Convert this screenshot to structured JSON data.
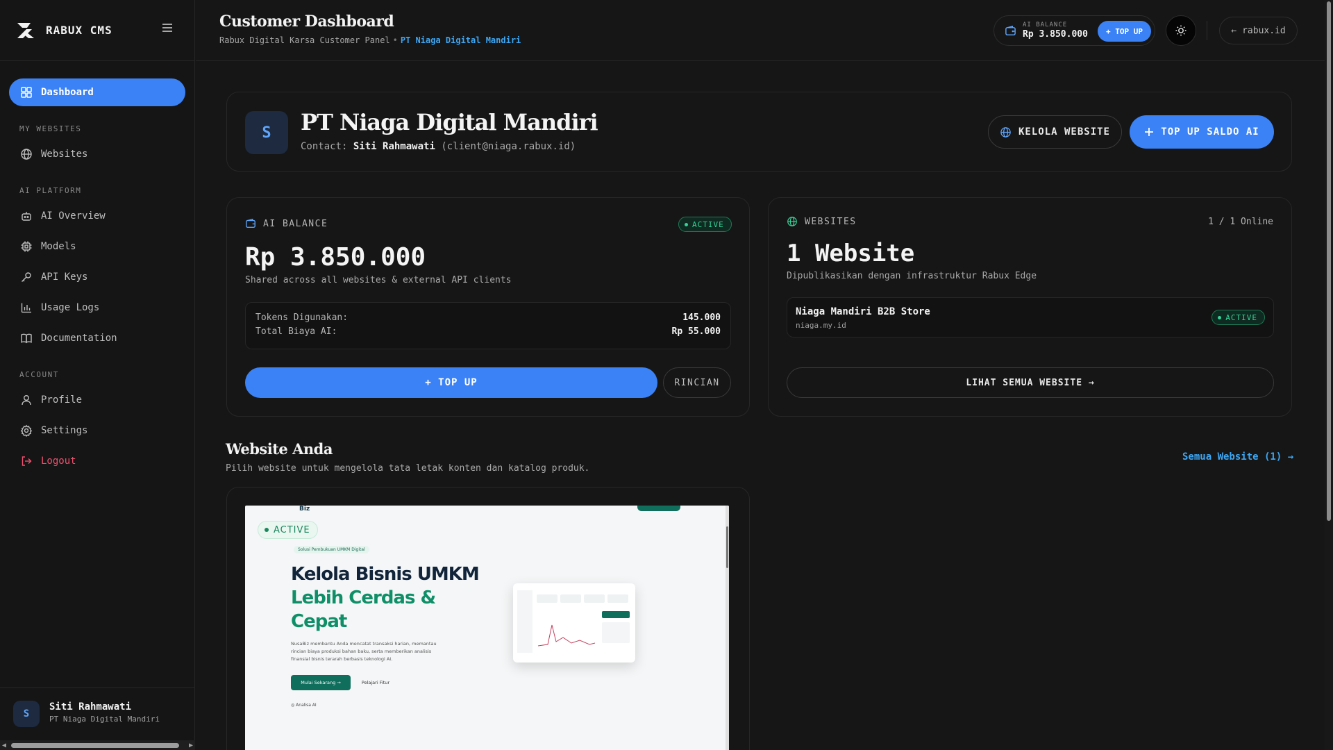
{
  "sidebar": {
    "brand": "RABUX CMS",
    "dashboard_label": "Dashboard",
    "section_my_websites": "MY WEBSITES",
    "websites_label": "Websites",
    "section_ai_platform": "AI PLATFORM",
    "ai_overview_label": "AI Overview",
    "models_label": "Models",
    "api_keys_label": "API Keys",
    "usage_logs_label": "Usage Logs",
    "documentation_label": "Documentation",
    "section_account": "ACCOUNT",
    "profile_label": "Profile",
    "settings_label": "Settings",
    "logout_label": "Logout",
    "user": {
      "initial": "S",
      "name": "Siti Rahmawati",
      "org": "PT Niaga Digital Mandiri"
    }
  },
  "topbar": {
    "title": "Customer Dashboard",
    "breadcrumb_root": "Rabux Digital Karsa Customer Panel",
    "breadcrumb_sep": "•",
    "breadcrumb_current": "PT Niaga Digital Mandiri",
    "balance_label": "AI BALANCE",
    "balance_value": "Rp 3.850.000",
    "topup_label": "+ TOP UP",
    "back_label": "rabux.id"
  },
  "profile": {
    "initial": "S",
    "org_name": "PT Niaga Digital Mandiri",
    "contact_prefix": "Contact:",
    "contact_name": "Siti Rahmawati",
    "contact_email": "(client@niaga.rabux.id)",
    "manage_label": "KELOLA WEBSITE",
    "topup_label": "TOP UP SALDO AI"
  },
  "balance_card": {
    "label": "AI BALANCE",
    "status": "ACTIVE",
    "value": "Rp 3.850.000",
    "subtitle": "Shared across all websites & external API clients",
    "tokens_label": "Tokens Digunakan:",
    "tokens_value": "145.000",
    "cost_label": "Total Biaya AI:",
    "cost_value": "Rp 55.000",
    "topup_label": "+ TOP UP",
    "detail_label": "RINCIAN"
  },
  "websites_card": {
    "label": "WEBSITES",
    "online": "1 / 1 Online",
    "count": "1 Website",
    "subtitle": "Dipublikasikan dengan infrastruktur Rabux Edge",
    "site_name": "Niaga Mandiri B2B Store",
    "site_domain": "niaga.my.id",
    "site_status": "ACTIVE",
    "view_all_label": "LIHAT SEMUA WEBSITE →"
  },
  "websites_section": {
    "title": "Website Anda",
    "subtitle": "Pilih website untuk mengelola tata letak konten dan katalog produk.",
    "all_link": "Semua Website (1) →"
  },
  "preview": {
    "status": "ACTIVE",
    "logo": "Biz",
    "tag": "Solusi Pembukuan UMKM Digital",
    "headline_1": "Kelola Bisnis UMKM",
    "headline_2": "Lebih Cerdas &",
    "headline_3": "Cepat",
    "paragraph": "NusaBiz membantu Anda mencatat transaksi harian, memantau rincian biaya produksi bahan baku, serta memberikan analisis finansial bisnis terarah berbasis teknologi AI.",
    "cta_primary": "Mulai Sekarang →",
    "cta_secondary": "Pelajari Fitur",
    "note": "Analisa AI"
  },
  "colors": {
    "accent": "#3b82f6",
    "success": "#34d399",
    "link": "#3ea6f2",
    "danger": "#f0506e"
  }
}
